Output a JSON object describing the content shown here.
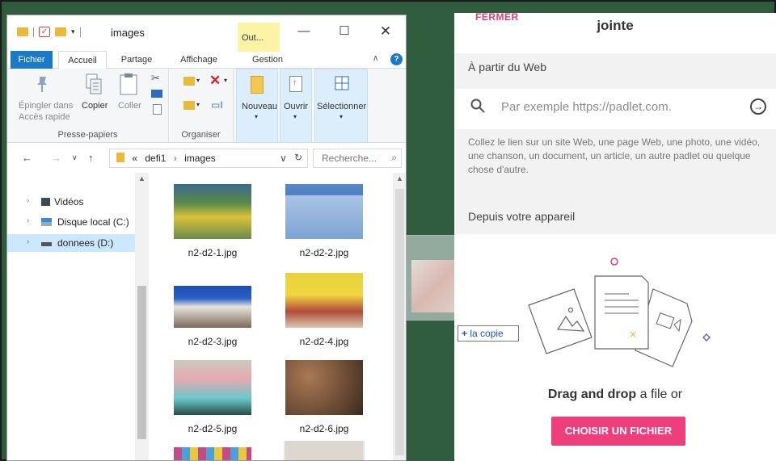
{
  "explorer": {
    "title": "images",
    "contextual_tab": "Out...",
    "tabs": [
      "Fichier",
      "Accueil",
      "Partage",
      "Affichage",
      "Gestion"
    ],
    "ribbon": {
      "pin_label_1": "Épingler dans",
      "pin_label_2": "Accès rapide",
      "copy_label": "Copier",
      "paste_label": "Coller",
      "clipboard_group": "Presse-papiers",
      "organize_group": "Organiser",
      "new_label": "Nouveau",
      "open_label": "Ouvrir",
      "select_label": "Sélectionner"
    },
    "address": {
      "overflow": "«",
      "crumb_1": "defi1",
      "crumb_2": "images",
      "search_placeholder": "Recherche..."
    },
    "nav_tree": [
      {
        "label": "Vidéos"
      },
      {
        "label": "Disque local (C:)"
      },
      {
        "label": "donnees (D:)"
      }
    ],
    "files": [
      {
        "name": "n2-d2-1.jpg"
      },
      {
        "name": "n2-d2-2.jpg"
      },
      {
        "name": "n2-d2-3.jpg"
      },
      {
        "name": "n2-d2-4.jpg"
      },
      {
        "name": "n2-d2-5.jpg"
      },
      {
        "name": "n2-d2-6.jpg"
      }
    ]
  },
  "drag": {
    "tooltip_plus": "+",
    "tooltip_text": "la copie"
  },
  "panel": {
    "close_label": "FERMER",
    "title": "jointe",
    "web_section": "À partir du Web",
    "url_placeholder": "Par exemple https://padlet.com.",
    "help_text": "Collez le lien sur un site Web, une page Web, une photo, une vidéo, une chanson, un document, un article, un autre padlet ou quelque chose d'autre.",
    "device_section": "Depuis votre appareil",
    "drop_bold": "Drag and drop",
    "drop_rest": "a file or",
    "choose_button": "CHOISIR UN FICHIER",
    "accent_color": "#ee3f7c"
  }
}
